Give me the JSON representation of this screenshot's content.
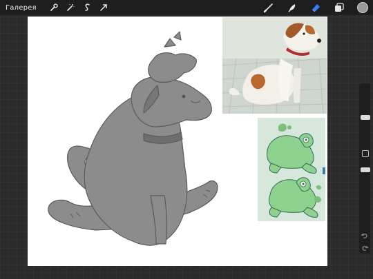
{
  "topbar": {
    "gallery_label": "Галерея",
    "left_tools": [
      "wrench-icon",
      "magic-wand-icon",
      "selection-s-icon",
      "transform-arrow-icon"
    ],
    "right_tools": [
      "brush-icon",
      "smudge-icon",
      "eraser-icon",
      "layers-icon"
    ],
    "active_tool": "eraser",
    "accent_color": "#3a7bff",
    "current_color": "#9a9a9a"
  },
  "canvas": {
    "background": "#ffffff",
    "sketch_fill": "#8c8c8c",
    "references": [
      "jack-russell-terrier-photo",
      "green-frog-sketches"
    ]
  },
  "sidebar": {
    "brush_size_level": 0.2,
    "opacity_level": 0.5,
    "buttons": [
      "modify-button",
      "undo-icon",
      "redo-icon"
    ]
  }
}
